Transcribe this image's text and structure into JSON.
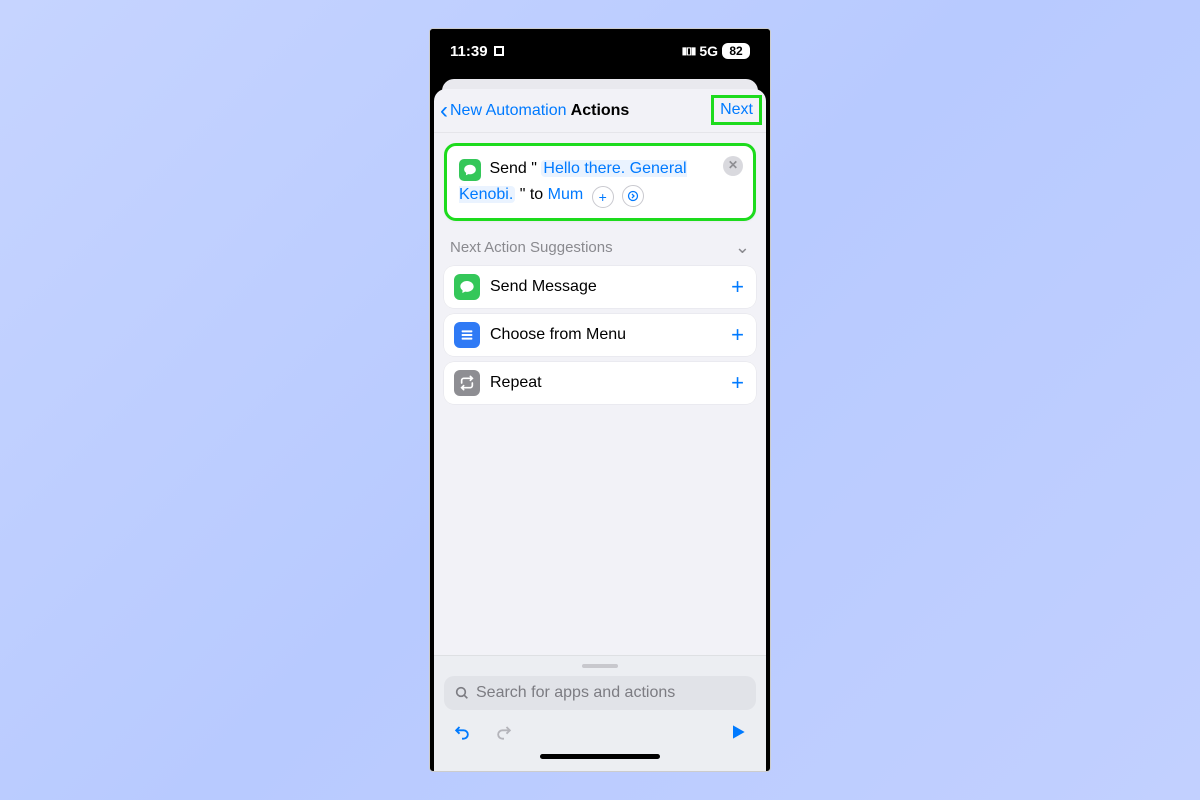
{
  "statusbar": {
    "time": "11:39",
    "network": "5G",
    "battery": "82"
  },
  "nav": {
    "back": "New Automation",
    "title": "Actions",
    "next": "Next"
  },
  "action": {
    "prefix_send": "Send \"",
    "message": "Hello there. General Kenobi.",
    "mid": "\" to",
    "recipient": "Mum"
  },
  "suggestions": {
    "header": "Next Action Suggestions",
    "items": [
      {
        "label": "Send Message",
        "icon": "messages"
      },
      {
        "label": "Choose from Menu",
        "icon": "menu"
      },
      {
        "label": "Repeat",
        "icon": "repeat"
      }
    ]
  },
  "search": {
    "placeholder": "Search for apps and actions"
  }
}
